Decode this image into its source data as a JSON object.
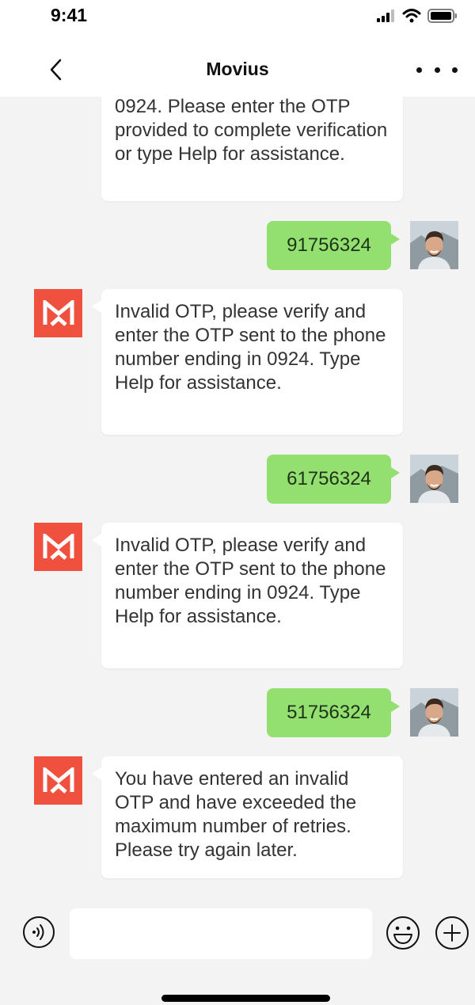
{
  "status_bar": {
    "time": "9:41"
  },
  "nav": {
    "title": "Movius"
  },
  "messages": [
    {
      "from": "bot",
      "text": "0924. Please enter the OTP provided to complete verification or type Help for assistance."
    },
    {
      "from": "user",
      "text": "91756324"
    },
    {
      "from": "bot",
      "text": "Invalid OTP, please verify and enter the OTP sent to the phone number ending in 0924. Type Help for assistance."
    },
    {
      "from": "user",
      "text": "61756324"
    },
    {
      "from": "bot",
      "text": "Invalid OTP, please verify and enter the OTP sent to the phone number ending in 0924. Type Help for assistance."
    },
    {
      "from": "user",
      "text": "51756324"
    },
    {
      "from": "bot",
      "text": "You have entered an invalid OTP and have exceeded the maximum number of retries. Please try again later."
    }
  ],
  "composer": {
    "input_value": "",
    "placeholder": ""
  },
  "colors": {
    "user_bubble": "#93e070",
    "bot_avatar": "#f0503e",
    "background": "#f3f3f3"
  },
  "icons": {
    "back": "chevron-left-icon",
    "more": "more-dots-icon",
    "voice": "voice-icon",
    "emoji": "emoji-icon",
    "add": "plus-circle-icon"
  }
}
